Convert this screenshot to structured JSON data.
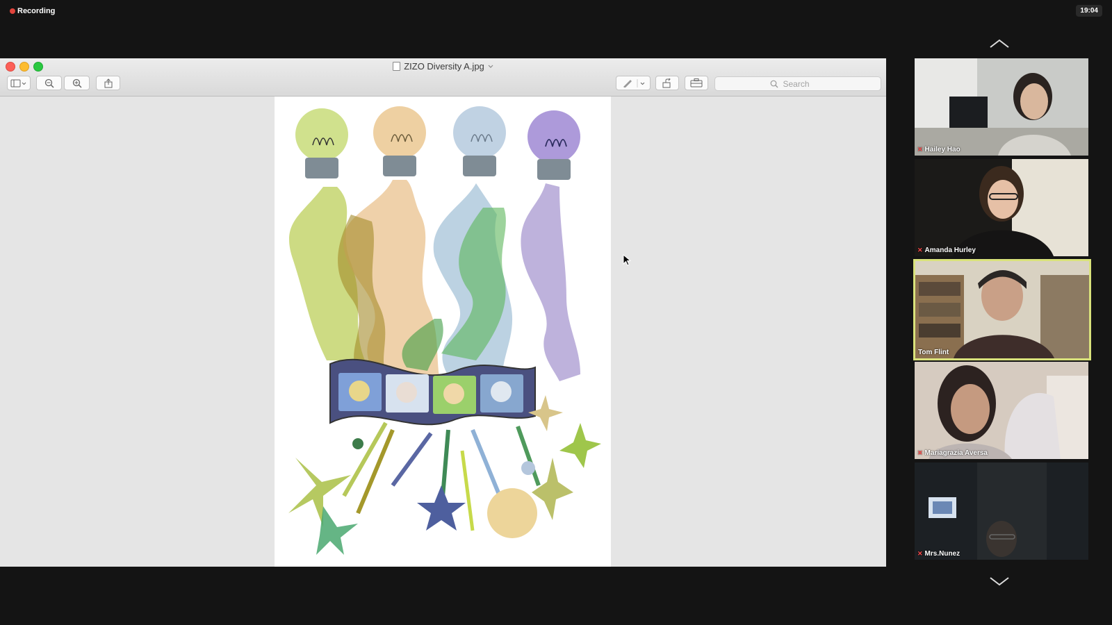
{
  "top_bar": {
    "recording_label": "Recording",
    "clock": "19:04"
  },
  "preview_window": {
    "title": "ZIZO Diversity A.jpg",
    "search_placeholder": "Search"
  },
  "participants": [
    {
      "name": "Hailey Hao",
      "muted": true,
      "active": false
    },
    {
      "name": "Amanda Hurley",
      "muted": true,
      "active": false
    },
    {
      "name": "Tom Flint",
      "muted": false,
      "active": true
    },
    {
      "name": "Mariagrazia Aversa",
      "muted": true,
      "active": false
    },
    {
      "name": "Mrs.Nunez",
      "muted": true,
      "active": false
    }
  ],
  "colors": {
    "active_speaker_border": "#d9e27b",
    "recording_dot": "#e0443c"
  }
}
